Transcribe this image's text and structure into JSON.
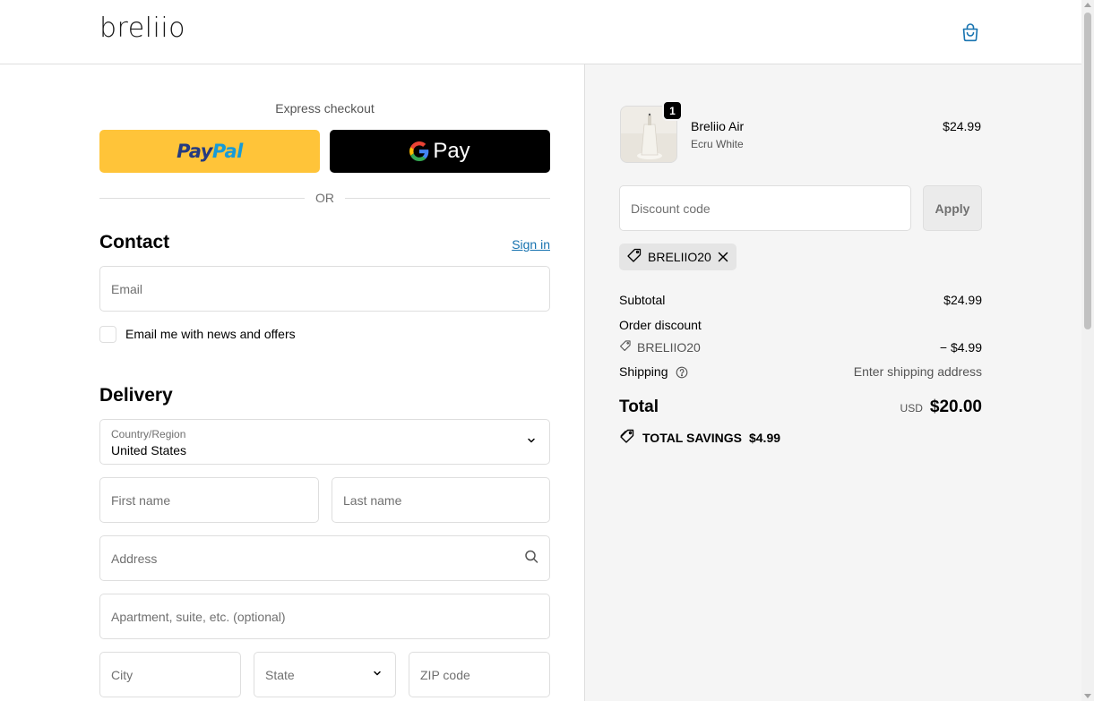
{
  "header": {
    "logo": "breliio",
    "cart_icon": "shopping-bag-icon"
  },
  "express": {
    "label": "Express checkout",
    "paypal_pay": "Pay",
    "paypal_pal": "Pal",
    "gpay_label": "Pay",
    "or_label": "OR"
  },
  "contact": {
    "title": "Contact",
    "signin_label": "Sign in",
    "email_placeholder": "Email",
    "newsletter_label": "Email me with news and offers"
  },
  "delivery": {
    "title": "Delivery",
    "country_label": "Country/Region",
    "country_value": "United States",
    "first_name_placeholder": "First name",
    "last_name_placeholder": "Last name",
    "address_placeholder": "Address",
    "apartment_placeholder": "Apartment, suite, etc. (optional)",
    "city_placeholder": "City",
    "state_placeholder": "State",
    "zip_placeholder": "ZIP code"
  },
  "order": {
    "product": {
      "quantity": "1",
      "name": "Breliio Air",
      "variant": "Ecru White",
      "price": "$24.99"
    },
    "discount_placeholder": "Discount code",
    "apply_label": "Apply",
    "applied_code": "BRELIIO20",
    "subtotal_label": "Subtotal",
    "subtotal_value": "$24.99",
    "order_discount_label": "Order discount",
    "discount_code": "BRELIIO20",
    "discount_value": "− $4.99",
    "shipping_label": "Shipping",
    "shipping_value": "Enter shipping address",
    "total_label": "Total",
    "currency": "USD",
    "total_value": "$20.00",
    "savings_label": "TOTAL SAVINGS",
    "savings_value": "$4.99"
  },
  "colors": {
    "paypal_yellow": "#ffc439",
    "link_blue": "#1773b0",
    "summary_bg": "#f5f5f5"
  }
}
